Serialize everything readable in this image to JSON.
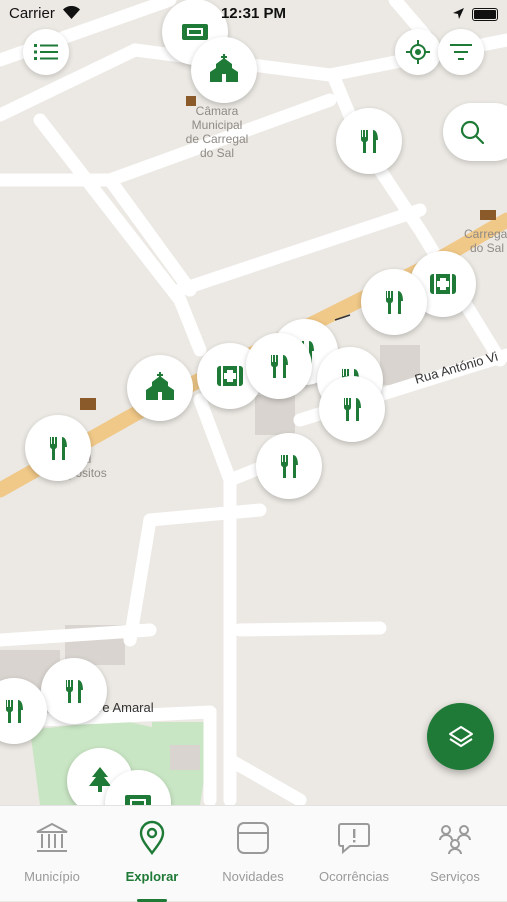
{
  "status_bar": {
    "carrier": "Carrier",
    "time": "12:31 PM"
  },
  "map": {
    "place_labels": {
      "camara": "Câmara\nMunicipal\nde Carregal\ndo Sal",
      "post": "Carregal\ndo Sal",
      "geral": "Geral\nepósitos"
    },
    "streets": {
      "rua_antonio": "Rua António Vi",
      "amaral": "re Amaral"
    }
  },
  "tabs": [
    {
      "label": "Município",
      "icon": "museum-icon",
      "active": false
    },
    {
      "label": "Explorar",
      "icon": "location-pin-icon",
      "active": true
    },
    {
      "label": "Novidades",
      "icon": "news-card-icon",
      "active": false
    },
    {
      "label": "Ocorrências",
      "icon": "alert-bubble-icon",
      "active": false
    },
    {
      "label": "Serviços",
      "icon": "people-network-icon",
      "active": false
    }
  ],
  "colors": {
    "accent": "#1e7a36",
    "map_bg": "#ece9e4",
    "major_road": "#f0c888"
  }
}
